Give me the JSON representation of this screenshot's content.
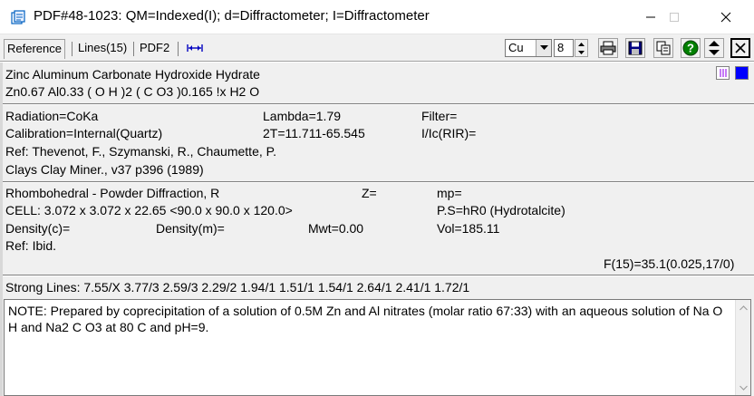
{
  "window": {
    "title": "PDF#48-1023: QM=Indexed(I); d=Diffractometer; I=Diffractometer"
  },
  "tabs": [
    {
      "label": "Reference"
    },
    {
      "label": "Lines(15)"
    },
    {
      "label": "PDF2"
    }
  ],
  "toolbar": {
    "anode_select": "Cu",
    "wavelength_value": "8"
  },
  "swatch_colors": {
    "purple": "#a020f0",
    "blue": "#0000ff"
  },
  "compound": {
    "name": "Zinc Aluminum Carbonate Hydroxide Hydrate",
    "formula": "Zn0.67 Al0.33 ( O H )2 ( C O3 )0.165 !x H2 O"
  },
  "experiment": {
    "radiation": "Radiation=CoKa",
    "lambda": "Lambda=1.79",
    "filter": "Filter=",
    "calibration": "Calibration=Internal(Quartz)",
    "two_theta": "2T=11.711-65.545",
    "i_ic": "I/Ic(RIR)=",
    "ref_authors": "Ref: Thevenot, F., Szymanski, R., Chaumette, P.",
    "ref_journal": "Clays Clay Miner., v37 p396 (1989)"
  },
  "crystal": {
    "system": "Rhombohedral - Powder Diffraction,  R",
    "z": "Z=",
    "mp": "mp=",
    "cell": "CELL: 3.072 x 3.072 x 22.65 <90.0 x 90.0 x 120.0>",
    "ps": "P.S=hR0 (Hydrotalcite)",
    "density_c": "Density(c)=",
    "density_m": "Density(m)=",
    "mwt": "Mwt=0.00",
    "vol": "Vol=185.11",
    "ref": "Ref: Ibid.",
    "fom": "F(15)=35.1(0.025,17/0)"
  },
  "strong_lines": "Strong Lines: 7.55/X 3.77/3 2.59/3 2.29/2 1.94/1 1.51/1 1.54/1 2.64/1 2.41/1 1.72/1",
  "note": "NOTE:  Prepared by coprecipitation of a solution of 0.5M Zn and Al nitrates (molar ratio 67:33) with an aqueous solution of Na O H and Na2 C O3 at 80 C and pH=9."
}
